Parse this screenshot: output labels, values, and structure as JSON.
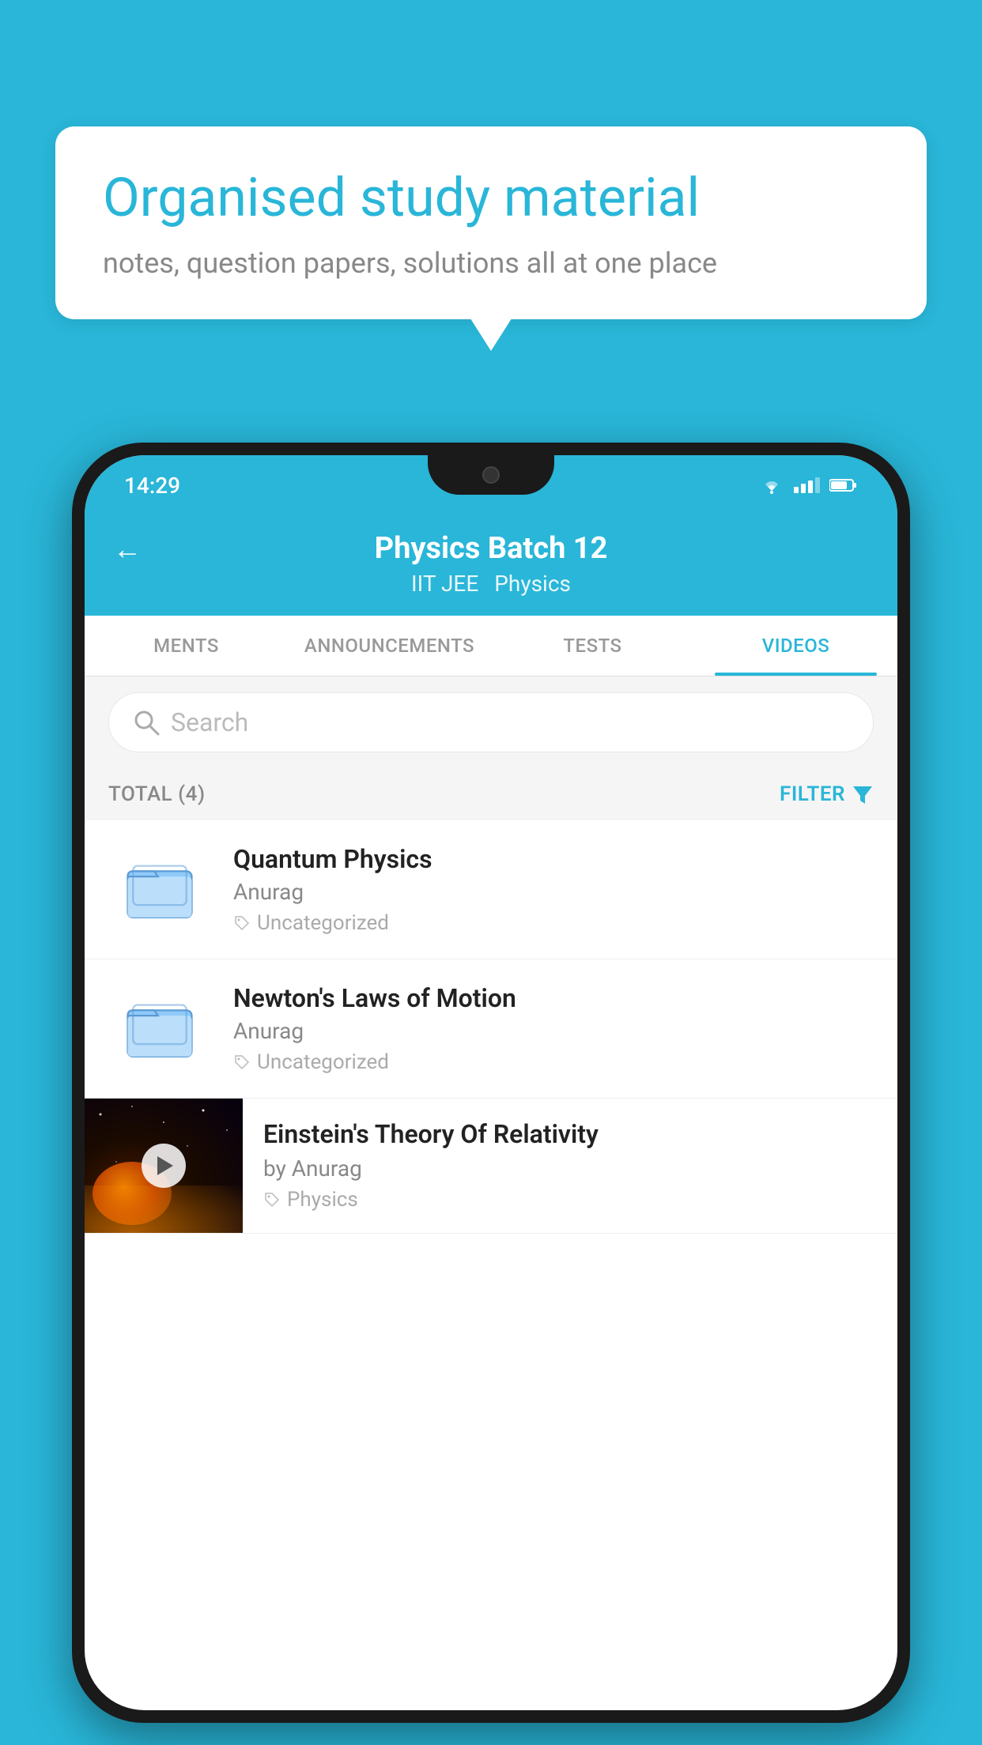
{
  "background": {
    "color": "#29b6d8"
  },
  "speech_bubble": {
    "title": "Organised study material",
    "subtitle": "notes, question papers, solutions all at one place"
  },
  "phone": {
    "status_bar": {
      "time": "14:29"
    },
    "header": {
      "back_label": "←",
      "title": "Physics Batch 12",
      "tag1": "IIT JEE",
      "tag2": "Physics"
    },
    "tabs": [
      {
        "label": "MENTS",
        "active": false
      },
      {
        "label": "ANNOUNCEMENTS",
        "active": false
      },
      {
        "label": "TESTS",
        "active": false
      },
      {
        "label": "VIDEOS",
        "active": true
      }
    ],
    "search": {
      "placeholder": "Search"
    },
    "filter": {
      "total_label": "TOTAL (4)",
      "filter_label": "FILTER"
    },
    "videos": [
      {
        "id": 1,
        "title": "Quantum Physics",
        "author": "Anurag",
        "tag": "Uncategorized",
        "type": "folder"
      },
      {
        "id": 2,
        "title": "Newton's Laws of Motion",
        "author": "Anurag",
        "tag": "Uncategorized",
        "type": "folder"
      },
      {
        "id": 3,
        "title": "Einstein's Theory Of Relativity",
        "author": "by Anurag",
        "tag": "Physics",
        "type": "video"
      }
    ]
  }
}
